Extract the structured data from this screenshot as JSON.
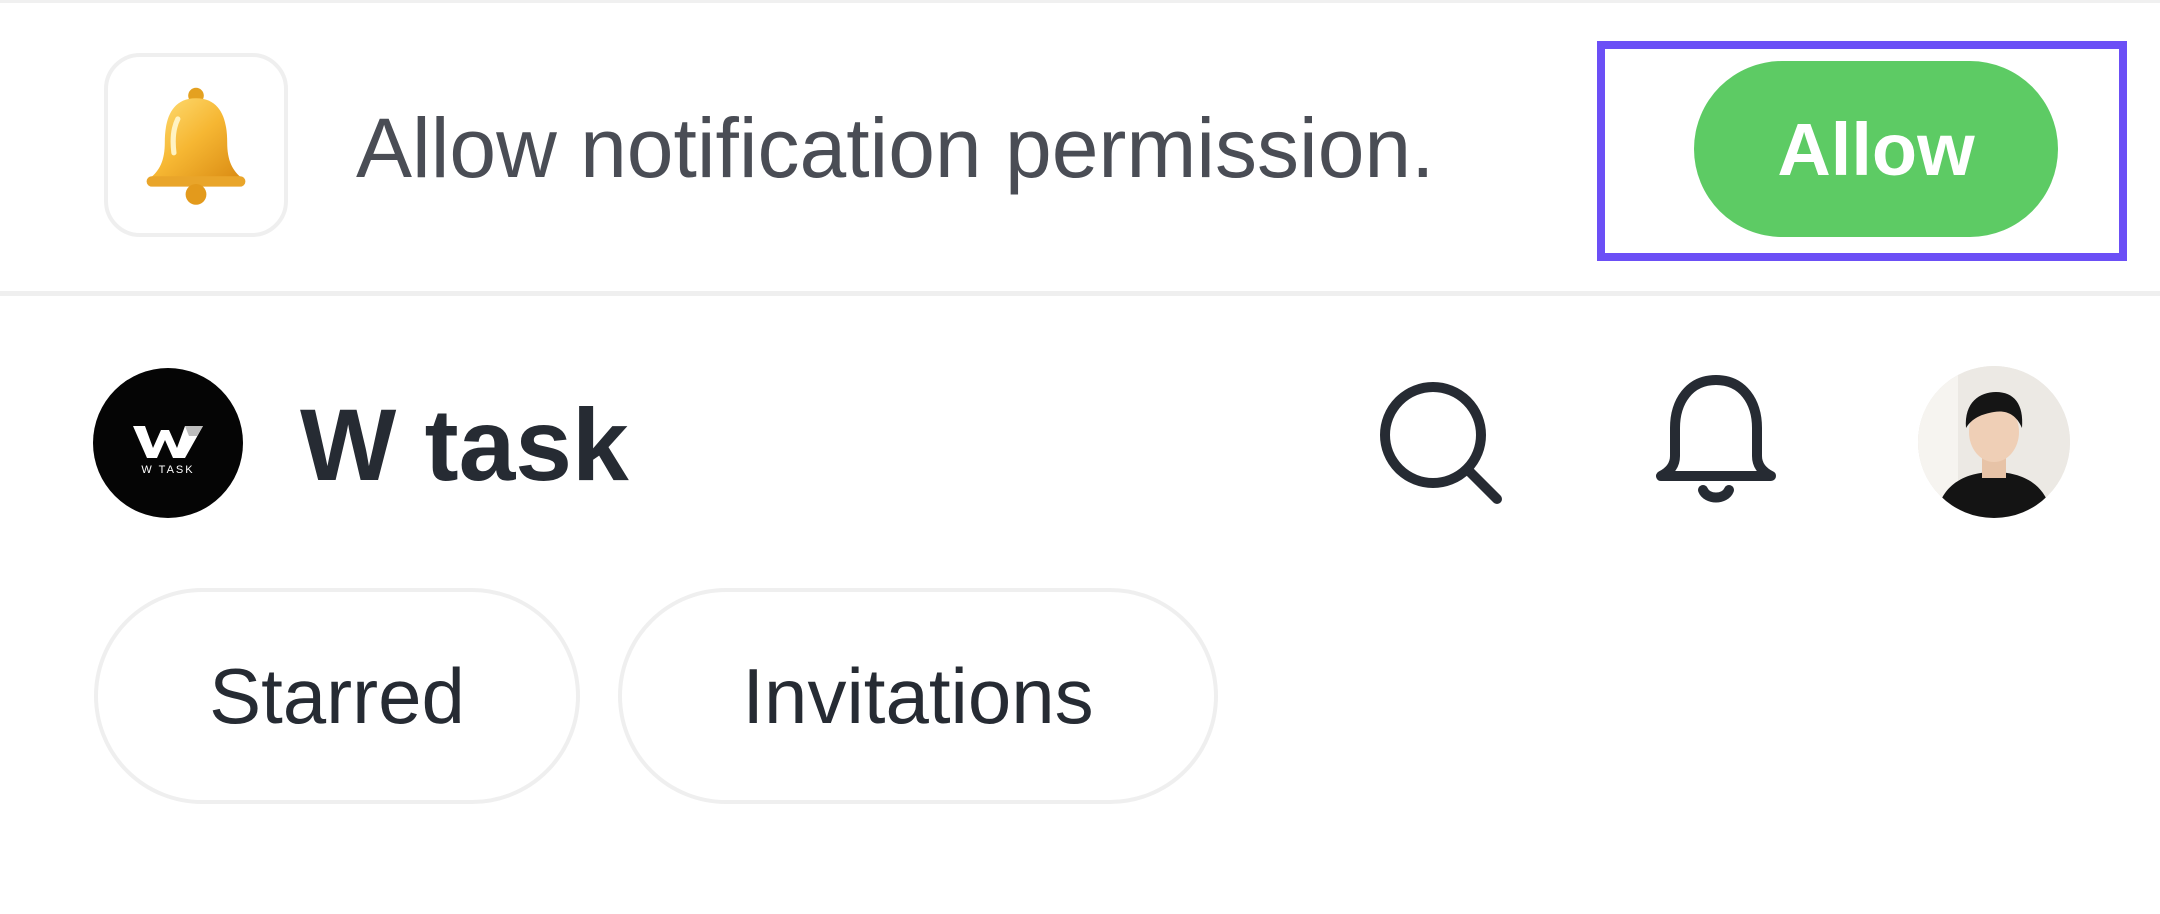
{
  "banner": {
    "icon": "bell-emoji-icon",
    "message": "Allow notification permission.",
    "allow_label": "Allow",
    "colors": {
      "allow_button": "#5dcb64",
      "highlight": "#6b4ff6",
      "text": "#4a4d55"
    }
  },
  "header": {
    "logo_text": "W TASK",
    "title": "W task",
    "search_icon": "search-icon",
    "notifications_icon": "bell-icon",
    "avatar_icon": "user-avatar"
  },
  "filters": {
    "chips": [
      {
        "label": "Starred"
      },
      {
        "label": "Invitations"
      }
    ]
  }
}
